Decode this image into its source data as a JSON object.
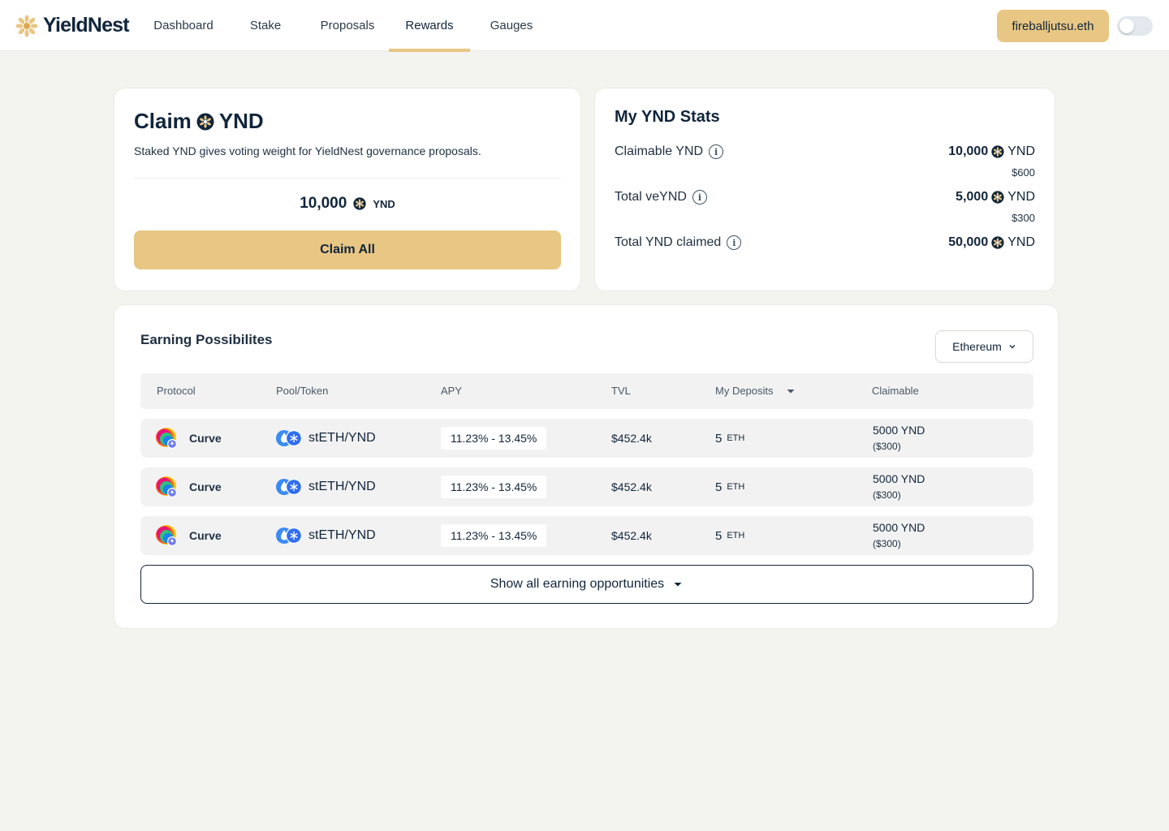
{
  "header": {
    "logo_text": "YieldNest",
    "logo_icon": "sun-flower-icon",
    "nav": [
      {
        "label": "Dashboard"
      },
      {
        "label": "Stake"
      },
      {
        "label": "Proposals"
      },
      {
        "label": "Rewards",
        "active": true
      },
      {
        "label": "Gauges"
      }
    ],
    "wallet_label": "fireballjutsu.eth",
    "theme_toggle": "off"
  },
  "claim": {
    "title_prefix": "Claim",
    "token": "YND",
    "description": "Staked YND gives voting weight for YieldNest governance proposals.",
    "amount": "10,000",
    "amount_symbol": "YND",
    "button_label": "Claim All"
  },
  "stats": {
    "title": "My YND Stats",
    "rows": [
      {
        "label": "Claimable YND",
        "value": "10,000",
        "symbol": "YND",
        "usd": "$600"
      },
      {
        "label": "Total veYND",
        "value": "5,000",
        "symbol": "YND",
        "usd": "$300"
      },
      {
        "label": "Total YND claimed",
        "value": "50,000",
        "symbol": "YND",
        "usd": ""
      }
    ]
  },
  "earning": {
    "title": "Earning Possibilites",
    "network": "Ethereum",
    "columns": [
      "Protocol",
      "Pool/Token",
      "APY",
      "TVL",
      "My Deposits",
      "Claimable"
    ],
    "rows": [
      {
        "protocol": "Curve",
        "pool": "stETH/YND",
        "apy": "11.23% - 13.45%",
        "tvl": "$452.4k",
        "deposit": "5",
        "deposit_unit": "ETH",
        "claimable": "5000 YND",
        "claimable_usd": "($300)"
      },
      {
        "protocol": "Curve",
        "pool": "stETH/YND",
        "apy": "11.23% - 13.45%",
        "tvl": "$452.4k",
        "deposit": "5",
        "deposit_unit": "ETH",
        "claimable": "5000 YND",
        "claimable_usd": "($300)"
      },
      {
        "protocol": "Curve",
        "pool": "stETH/YND",
        "apy": "11.23% - 13.45%",
        "tvl": "$452.4k",
        "deposit": "5",
        "deposit_unit": "ETH",
        "claimable": "5000 YND",
        "claimable_usd": "($300)"
      }
    ],
    "show_all_label": "Show all earning opportunities"
  },
  "colors": {
    "accent": "#e8c684",
    "text": "#11253b",
    "background": "#f3f3ef",
    "row_bg": "#f2f2f2"
  }
}
